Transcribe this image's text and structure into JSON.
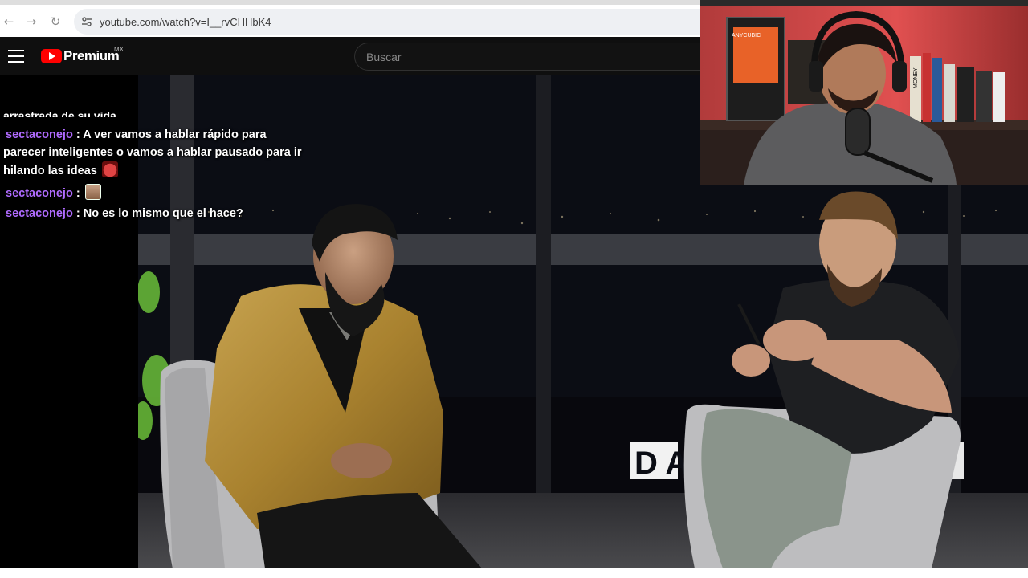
{
  "browser": {
    "url": "youtube.com/watch?v=I__rvCHHbK4",
    "back_icon": "arrow-left-icon",
    "forward_icon": "arrow-right-icon",
    "reload_icon": "reload-icon",
    "site_icon": "site-settings-icon"
  },
  "youtube": {
    "logo_text": "Premium",
    "region": "MX",
    "search_placeholder": "Buscar",
    "menu_icon": "hamburger-menu-icon"
  },
  "chat": {
    "partial_line": "arrastrada de su vida",
    "messages": [
      {
        "user": "sectaconejo",
        "separator": " : ",
        "text": "A ver vamos a hablar rápido para parecer inteligentes o vamos a hablar pausado para ir hilando las ideas",
        "emote": "red-devil-emote"
      },
      {
        "user": "sectaconejo",
        "separator": " : ",
        "text": "",
        "emote": "face-emote"
      },
      {
        "user": "sectaconejo",
        "separator": " : ",
        "text": "No es lo mismo que el hace?",
        "emote": ""
      }
    ]
  },
  "video_scene": {
    "sign_text": "D   A"
  },
  "webcam": {
    "printer_brand": "ANYCUBIC",
    "book_title": "MONEY"
  },
  "colors": {
    "youtube_red": "#ff0000",
    "chat_username": "#b06bff",
    "header_bg": "#0f0f0f"
  }
}
